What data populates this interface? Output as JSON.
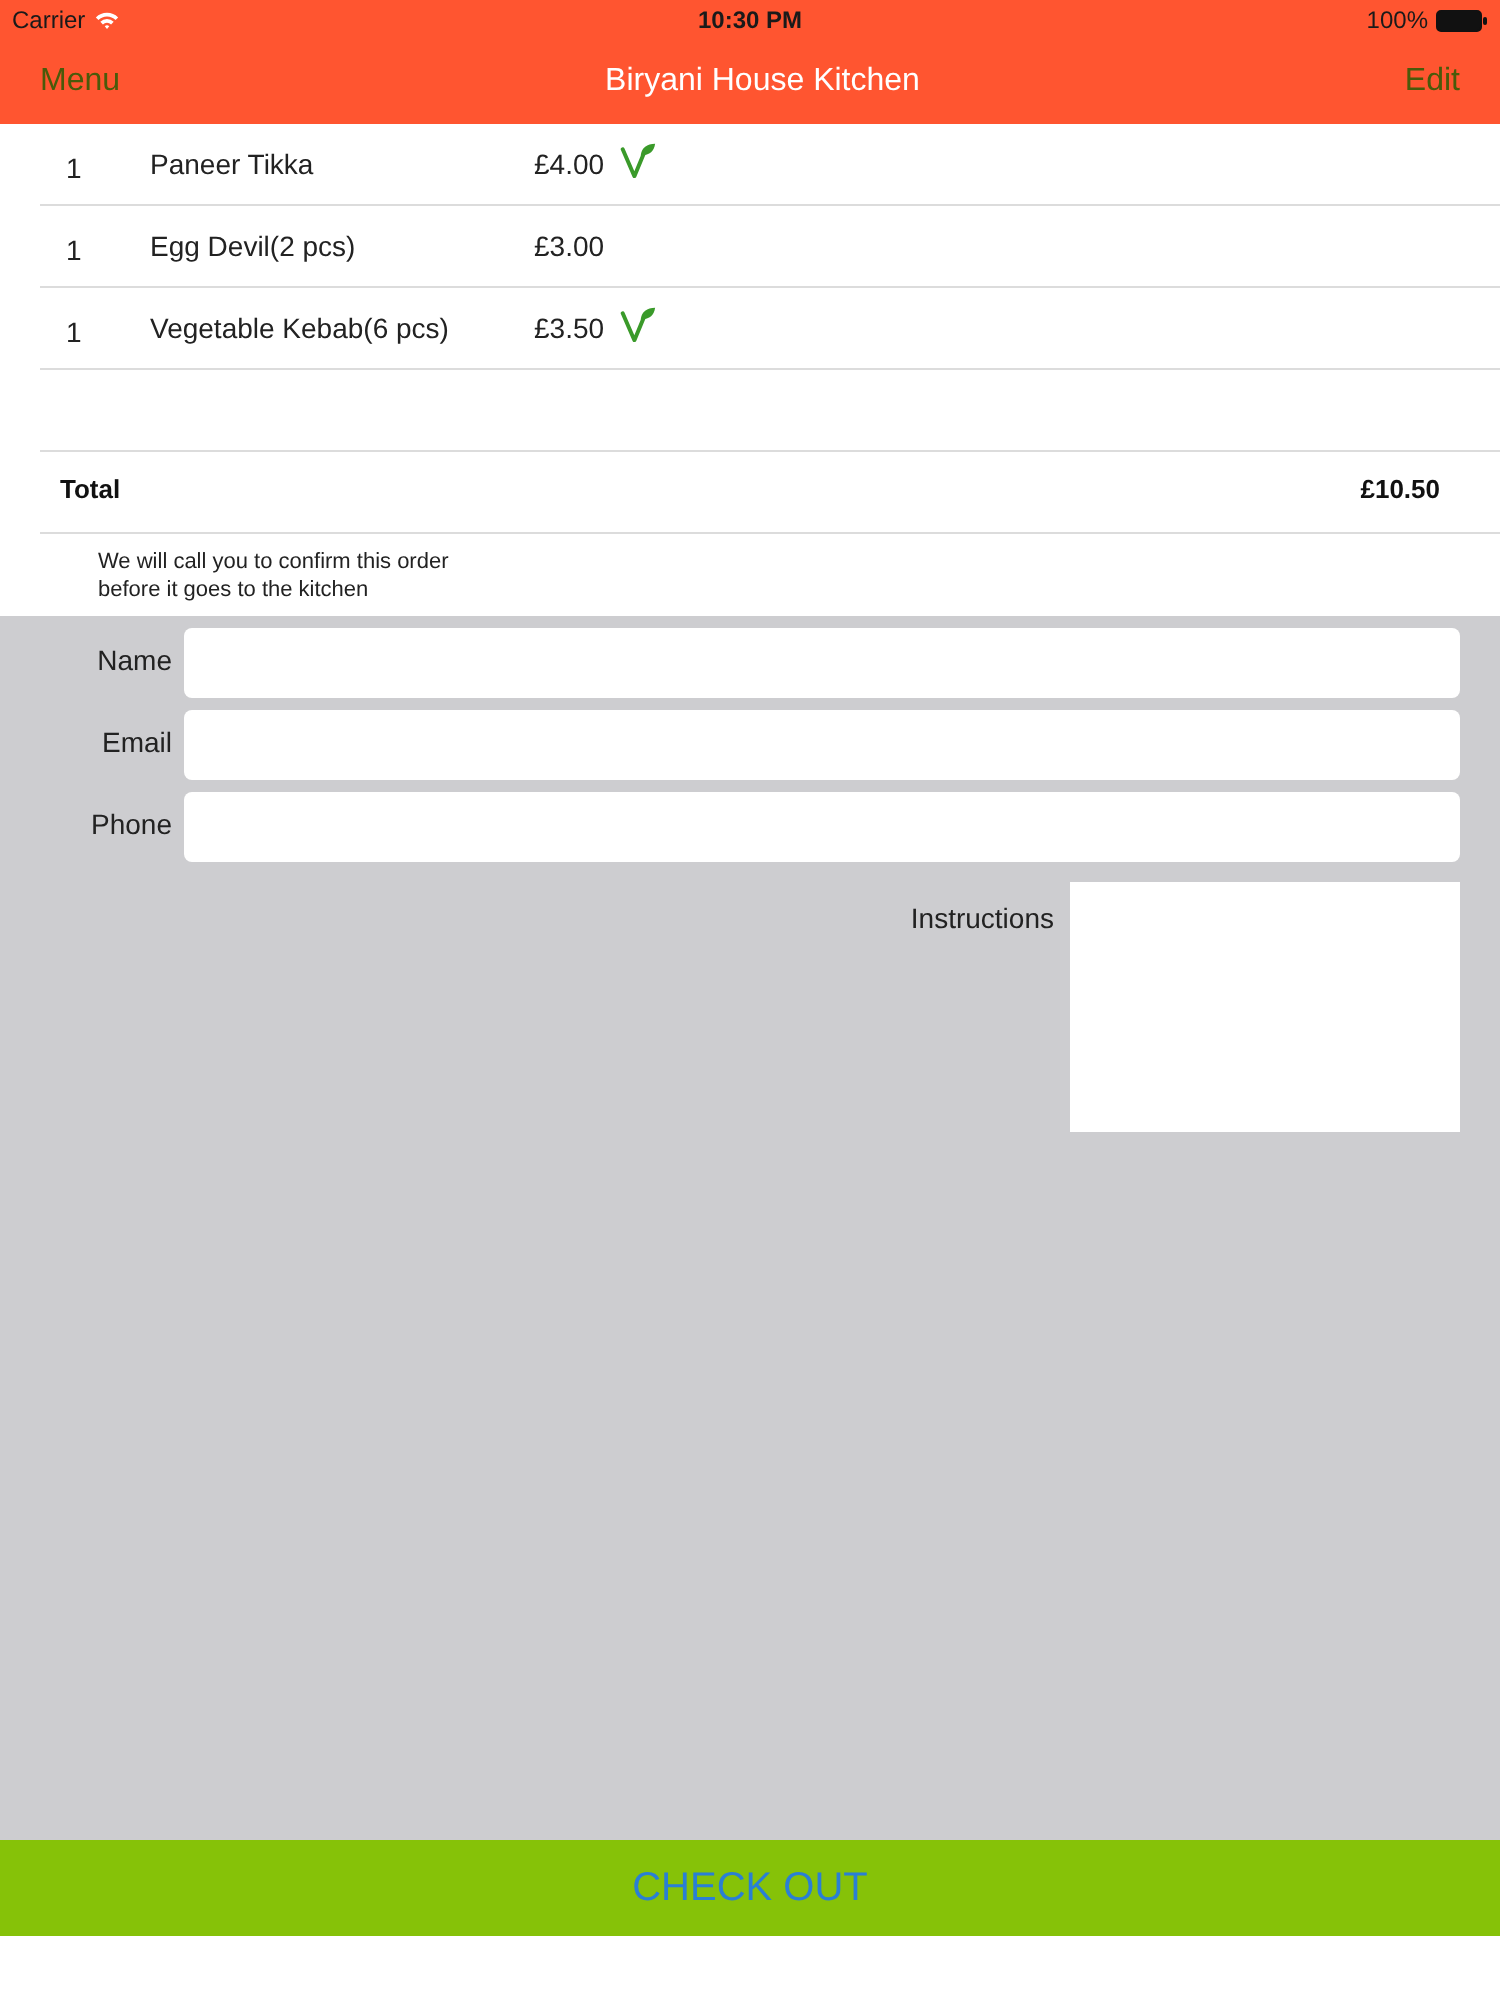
{
  "status_bar": {
    "carrier": "Carrier",
    "time": "10:30 PM",
    "battery": "100%"
  },
  "nav_bar": {
    "left_button": "Menu",
    "title": "Biryani House Kitchen",
    "right_button": "Edit"
  },
  "order_items": [
    {
      "quantity": "1",
      "name": "Paneer Tikka",
      "price": "£4.00",
      "vegetarian": true
    },
    {
      "quantity": "1",
      "name": "Egg Devil(2 pcs)",
      "price": "£3.00",
      "vegetarian": false
    },
    {
      "quantity": "1",
      "name": "Vegetable Kebab(6 pcs)",
      "price": "£3.50",
      "vegetarian": true
    }
  ],
  "total": {
    "label": "Total",
    "amount": "£10.50"
  },
  "note": "We will call you to confirm this order\nbefore it goes to the kitchen",
  "contact_form": {
    "fields": [
      {
        "label": "Name"
      },
      {
        "label": "Email"
      },
      {
        "label": "Phone"
      }
    ],
    "instructions": {
      "label": "Instructions"
    }
  },
  "checkout_button": "CHECK OUT"
}
